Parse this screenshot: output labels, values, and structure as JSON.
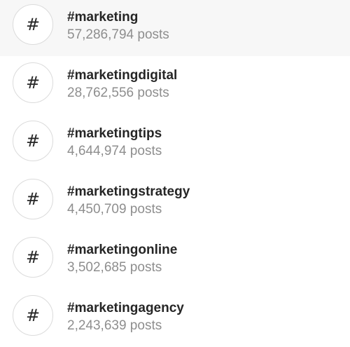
{
  "hashtag_results": [
    {
      "icon": "hash-icon",
      "glyph": "#",
      "tag": "#marketing",
      "posts": "57,286,794 posts"
    },
    {
      "icon": "hash-icon",
      "glyph": "#",
      "tag": "#marketingdigital",
      "posts": "28,762,556 posts"
    },
    {
      "icon": "hash-icon",
      "glyph": "#",
      "tag": "#marketingtips",
      "posts": "4,644,974 posts"
    },
    {
      "icon": "hash-icon",
      "glyph": "#",
      "tag": "#marketingstrategy",
      "posts": "4,450,709 posts"
    },
    {
      "icon": "hash-icon",
      "glyph": "#",
      "tag": "#marketingonline",
      "posts": "3,502,685 posts"
    },
    {
      "icon": "hash-icon",
      "glyph": "#",
      "tag": "#marketingagency",
      "posts": "2,243,639 posts"
    }
  ],
  "colors": {
    "highlight_background": "#f7f7f7",
    "tag_text": "#262626",
    "count_text": "#8e8e8e",
    "icon_border": "#dbdbdb"
  }
}
